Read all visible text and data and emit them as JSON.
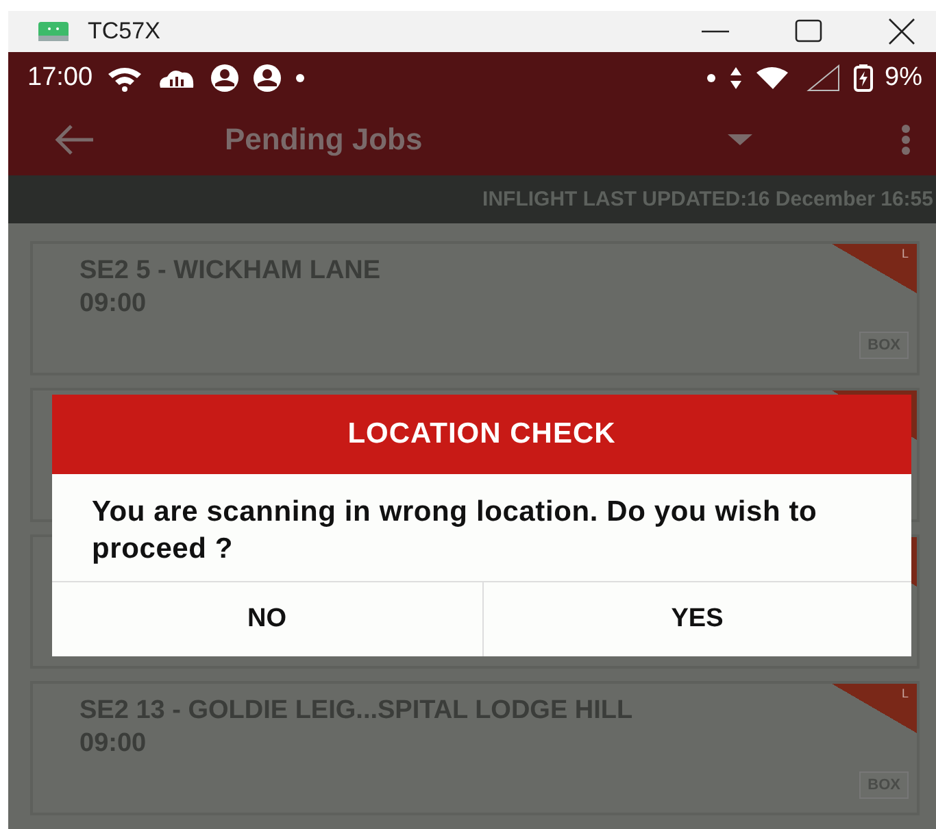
{
  "window": {
    "title": "TC57X"
  },
  "status_bar": {
    "time": "17:00",
    "battery": "9%"
  },
  "app_bar": {
    "title": "Pending Jobs"
  },
  "banner": {
    "text": "INFLIGHT LAST UPDATED:16 December 16:55"
  },
  "jobs": [
    {
      "kind": "job",
      "title": "SE2 5 - WICKHAM LANE",
      "time": "09:00",
      "flag": "L",
      "tag": "BOX"
    },
    {
      "kind": "covered"
    },
    {
      "kind": "covered"
    },
    {
      "kind": "job",
      "title": "SE2 13 - GOLDIE LEIG...SPITAL LODGE HILL",
      "time": "09:00",
      "flag": "L",
      "tag": "BOX"
    }
  ],
  "dialog": {
    "title": "LOCATION CHECK",
    "message": "You are scanning in wrong location. Do you wish to proceed ?",
    "buttons": [
      "NO",
      "YES"
    ]
  }
}
